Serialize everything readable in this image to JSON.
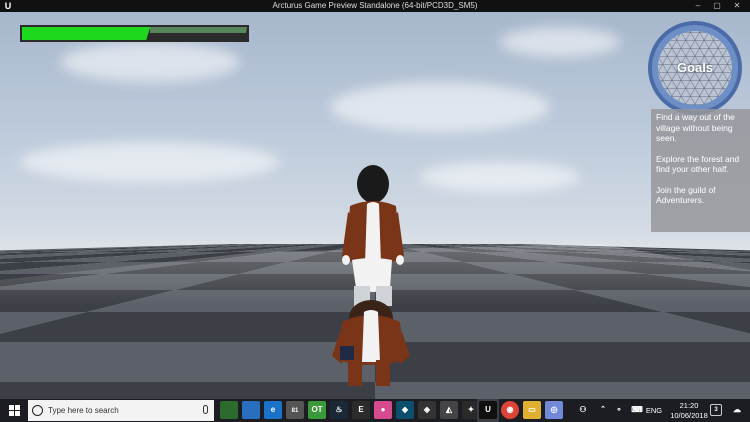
{
  "window": {
    "title": "Arcturus Game Preview Standalone (64-bit/PCD3D_SM5)",
    "logo_letter": "U",
    "minimize_glyph": "–",
    "maximize_glyph": "▢",
    "close_glyph": "✕"
  },
  "hud": {
    "health_fraction": 0.57,
    "health_color": "#1ed81e",
    "minimap": {
      "label": "Goals"
    },
    "goals": [
      "Find a way out of the village without being seen.",
      "Explore the forest and find your other half.",
      "Join the guild of Adventurers."
    ]
  },
  "taskbar": {
    "search_placeholder": "Type here to search",
    "pinned_icons": [
      "task-view-icon",
      "edge-icon",
      "store-icon",
      "opentoonz-icon",
      "steam-icon",
      "paint-icon",
      "photoshop-icon",
      "unity-icon",
      "inkscape-icon",
      "unreal-icon",
      "chrome-icon",
      "file-explorer-icon",
      "discord-icon"
    ],
    "store_badge": "81",
    "language": "ENG",
    "time": "21:20",
    "date": "10/06/2018",
    "notification_count": "3"
  }
}
